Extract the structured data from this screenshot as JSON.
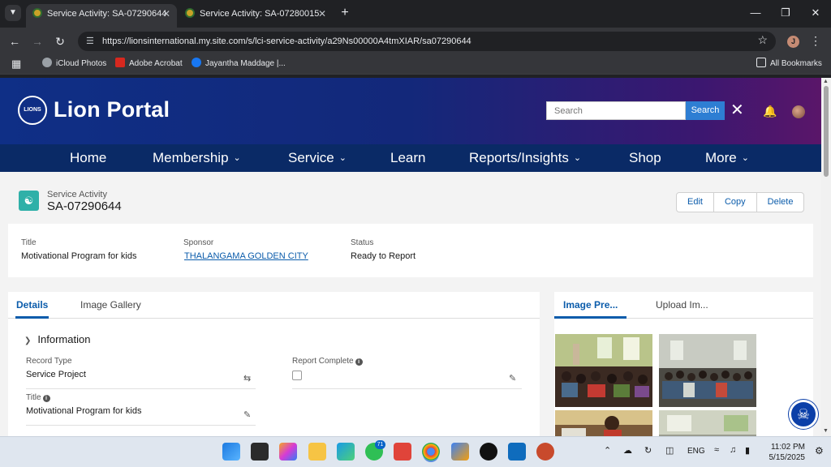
{
  "browser": {
    "tabs": [
      {
        "label": "Service Activity: SA-07290644",
        "active": true
      },
      {
        "label": "Service Activity: SA-07280015",
        "active": false
      }
    ],
    "url": "https://lionsinternational.my.site.com/s/lci-service-activity/a29Ns00000A4tmXIAR/sa07290644",
    "profile_initial": "J",
    "bookmarks": [
      "iCloud Photos",
      "Adobe Acrobat",
      "Jayantha Maddage |..."
    ],
    "all_bookmarks": "All Bookmarks"
  },
  "portal": {
    "brand": "Lion Portal",
    "search_placeholder": "Search",
    "search_button": "Search",
    "nav": [
      "Home",
      "Membership",
      "Service",
      "Learn",
      "Reports/Insights",
      "Shop",
      "More"
    ]
  },
  "record": {
    "object_label": "Service Activity",
    "name": "SA-07290644",
    "actions": [
      "Edit",
      "Copy",
      "Delete"
    ]
  },
  "highlights": {
    "title_label": "Title",
    "title_value": "Motivational Program for kids",
    "sponsor_label": "Sponsor",
    "sponsor_value": "THALANGAMA GOLDEN CITY",
    "status_label": "Status",
    "status_value": "Ready to Report"
  },
  "details": {
    "tabs": [
      "Details",
      "Image Gallery"
    ],
    "section": "Information",
    "record_type_label": "Record Type",
    "record_type_value": "Service Project",
    "report_complete_label": "Report Complete",
    "title_label": "Title",
    "title_value": "Motivational Program for kids"
  },
  "preview": {
    "tabs": [
      "Image Pre...",
      "Upload Im..."
    ]
  },
  "taskbar": {
    "whatsapp_badge": "71",
    "lang": "ENG",
    "time": "11:02 PM",
    "date": "5/15/2025"
  },
  "colors": {
    "brand_blue": "#0b5cab",
    "nav_bg": "#0a2a66",
    "record_icon": "#2fb0a8"
  }
}
